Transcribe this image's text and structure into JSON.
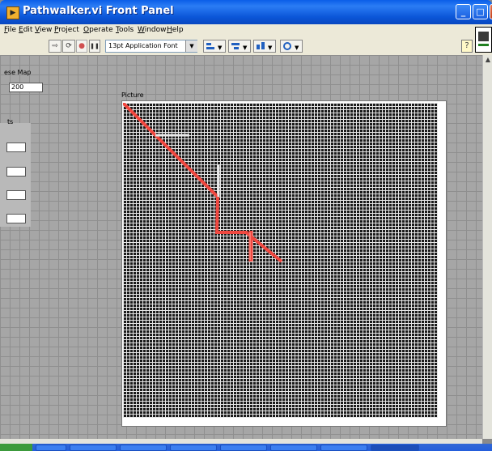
{
  "window": {
    "title": "Pathwalker.vi Front Panel",
    "app_icon_glyph": "▶",
    "minimize_glyph": "_",
    "maximize_glyph": "□",
    "close_glyph": "✕"
  },
  "menu": {
    "items": [
      "File",
      "Edit",
      "View",
      "Project",
      "Operate",
      "Tools",
      "Window",
      "Help"
    ]
  },
  "toolbar": {
    "run_glyph": "⇨",
    "run_cont_glyph": "⟳",
    "abort_glyph": "●",
    "pause_glyph": "❚❚",
    "font_select_value": "13pt Application Font",
    "help_glyph": "?"
  },
  "panel": {
    "maze_label": "ese Map",
    "maze_value": "200",
    "controls_label": "ts",
    "picture_label": "Picture"
  },
  "colors": {
    "path": "#f04840",
    "path_highlight": "#ff7a70",
    "marker": "#e8e8e8",
    "grid_bg": "#1a1a1a",
    "grid_lines": "#e6e6e6",
    "panel": "#a6a6a6"
  },
  "icons": [
    "app-icon",
    "run-arrow-icon",
    "run-continuous-icon",
    "abort-icon",
    "pause-icon",
    "help-icon",
    "vi-icon"
  ]
}
